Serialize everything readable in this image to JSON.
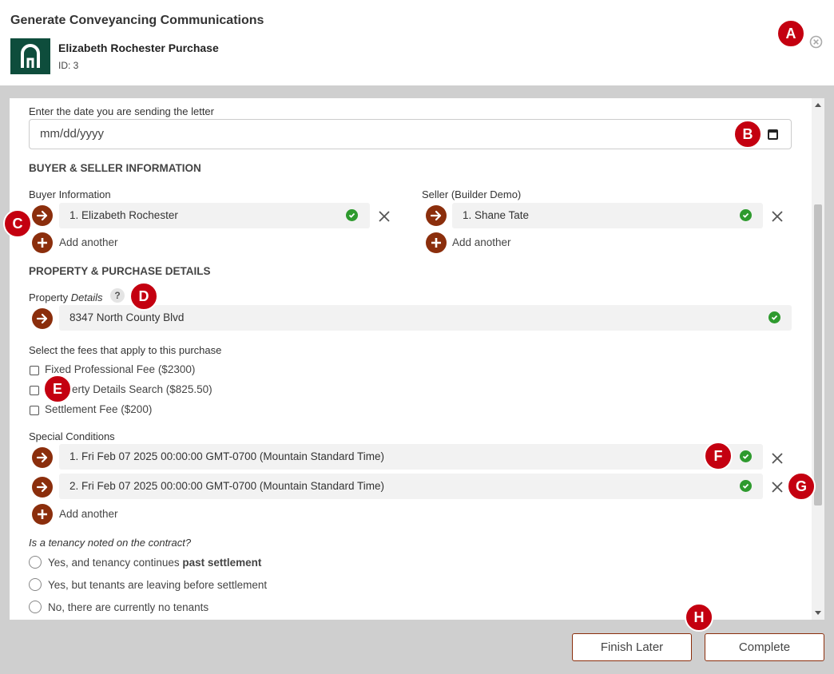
{
  "header": {
    "title": "Generate Conveyancing Communications",
    "case_name": "Elizabeth Rochester Purchase",
    "case_id": "ID: 3"
  },
  "markers": [
    "A",
    "B",
    "C",
    "D",
    "E",
    "F",
    "G",
    "H"
  ],
  "date_field": {
    "label": "Enter the date you are sending the letter",
    "placeholder": "mm/dd/yyyy"
  },
  "buyer_seller": {
    "section_title": "BUYER & SELLER INFORMATION",
    "buyer_label": "Buyer Information",
    "buyer_items": [
      "1. Elizabeth Rochester"
    ],
    "seller_label": "Seller (Builder Demo)",
    "seller_items": [
      "1. Shane Tate"
    ],
    "add_another": "Add another"
  },
  "property": {
    "section_title": "PROPERTY & PURCHASE DETAILS",
    "label_plain": "Property ",
    "label_italic": "Details",
    "help": "?",
    "value": "8347 North County Blvd"
  },
  "fees": {
    "label": "Select the fees that apply to this purchase",
    "options": [
      "Fixed Professional Fee ($2300)",
      "Property Details Search ($825.50)",
      "Settlement Fee ($200)"
    ],
    "visible_option_2": "erty Details Search ($825.50)"
  },
  "special_conditions": {
    "label": "Special Conditions",
    "items": [
      "1. Fri Feb 07 2025 00:00:00 GMT-0700 (Mountain Standard Time)",
      "2. Fri Feb 07 2025 00:00:00 GMT-0700 (Mountain Standard Time)"
    ],
    "add_another": "Add another"
  },
  "tenancy": {
    "question": "Is a tenancy noted on the contract?",
    "option1_prefix": "Yes, and tenancy continues ",
    "option1_bold": "past settlement",
    "option2": "Yes, but tenants are leaving before settlement",
    "option3": "No, there are currently no tenants"
  },
  "footer": {
    "finish_later": "Finish Later",
    "complete": "Complete"
  },
  "colors": {
    "accent": "#8b2e0c",
    "marker": "#c40010",
    "success": "#2e9a2e",
    "logo_bg": "#0e4d3c"
  },
  "icons": [
    "arrow-right-icon",
    "plus-icon",
    "check-circle-icon",
    "close-icon",
    "calendar-icon",
    "help-icon",
    "close-circle-icon"
  ]
}
